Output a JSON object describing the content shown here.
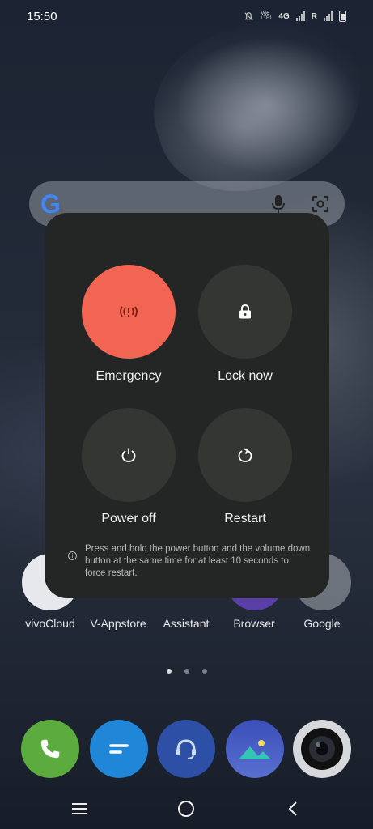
{
  "status": {
    "time": "15:50",
    "net_label": "4G",
    "volte": "Vo6 LTE1",
    "roaming": "R"
  },
  "power_menu": {
    "emergency_label": "Emergency",
    "lock_label": "Lock now",
    "power_off_label": "Power off",
    "restart_label": "Restart",
    "note": "Press and hold the power button and the volume down button at the same time for at least 10 seconds to force restart.",
    "accent_color": "#f26552"
  },
  "home": {
    "app_labels": [
      "vivoCloud",
      "V-Appstore",
      "Assistant",
      "Browser",
      "Google"
    ],
    "page_dots": 3,
    "active_dot": 0,
    "dock": [
      "phone-app",
      "messages-app",
      "support-app",
      "gallery-app",
      "camera-app"
    ]
  }
}
